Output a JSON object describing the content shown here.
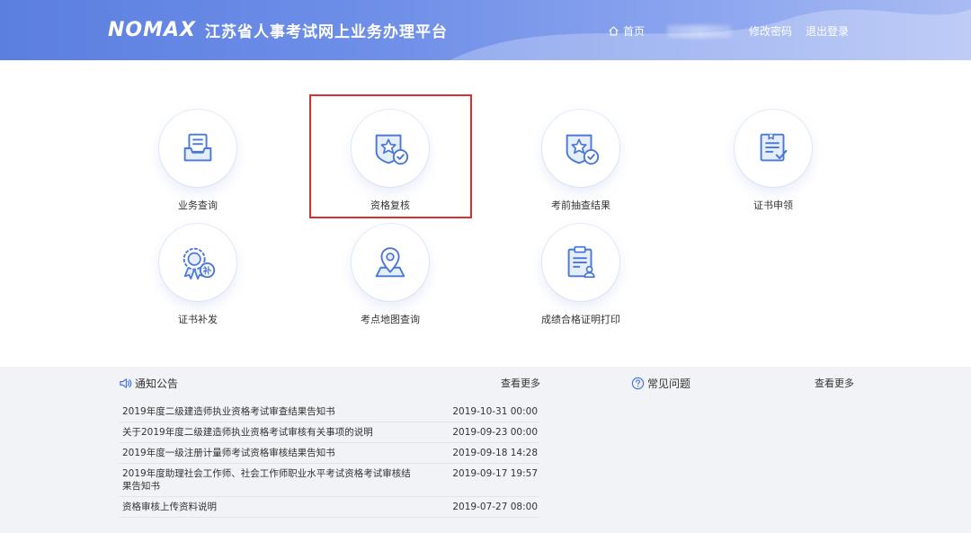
{
  "header": {
    "brand": "NOMAX",
    "title": "江苏省人事考试网上业务办理平台",
    "nav": {
      "home": "首页",
      "change_password": "修改密码",
      "logout": "退出登录"
    }
  },
  "tiles": [
    {
      "label": "业务查询",
      "icon": "tray-document-icon"
    },
    {
      "label": "资格复核",
      "icon": "star-shield-check-icon"
    },
    {
      "label": "考前抽查结果",
      "icon": "star-shield-check-icon"
    },
    {
      "label": "证书申领",
      "icon": "certificate-check-icon"
    },
    {
      "label": "证书补发",
      "icon": "medal-reissue-icon"
    },
    {
      "label": "考点地图查询",
      "icon": "map-pin-icon"
    },
    {
      "label": "成绩合格证明打印",
      "icon": "clipboard-user-icon"
    }
  ],
  "notices": {
    "title": "通知公告",
    "more": "查看更多",
    "items": [
      {
        "title": "2019年度二级建造师执业资格考试审查结果告知书",
        "date": "2019-10-31 00:00"
      },
      {
        "title": "关于2019年度二级建造师执业资格考试审核有关事项的说明",
        "date": "2019-09-23 00:00"
      },
      {
        "title": "2019年度一级注册计量师考试资格审核结果告知书",
        "date": "2019-09-18 14:28"
      },
      {
        "title": "2019年度助理社会工作师、社会工作师职业水平考试资格考试审核结果告知书",
        "date": "2019-09-17 19:57"
      },
      {
        "title": "资格审核上传资料说明",
        "date": "2019-07-27 08:00"
      }
    ]
  },
  "faq": {
    "title": "常见问题",
    "more": "查看更多"
  },
  "colors": {
    "header_start": "#5b7fe0",
    "header_end": "#a9bbf3",
    "icon_blue": "#4a78d8",
    "highlight_red": "#d9312e",
    "panel_bg": "#f1f3f7"
  }
}
